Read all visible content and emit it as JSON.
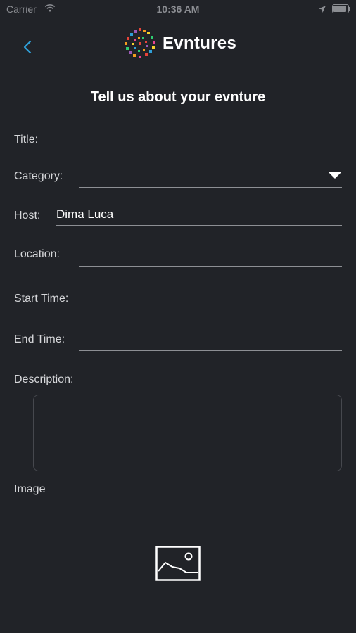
{
  "status_bar": {
    "carrier": "Carrier",
    "time": "10:36 AM",
    "battery_level": 1.0
  },
  "header": {
    "app_title": "Evntures",
    "back_icon": "chevron-left-icon",
    "accent_color": "#2f9fd8"
  },
  "form": {
    "heading": "Tell us about your evnture",
    "title_label": "Title:",
    "title_value": "",
    "category_label": "Category:",
    "category_value": "",
    "host_label": "Host:",
    "host_value": "Dima Luca",
    "location_label": "Location:",
    "location_value": "",
    "start_time_label": "Start Time:",
    "start_time_value": "",
    "end_time_label": "End Time:",
    "end_time_value": "",
    "description_label": "Description:",
    "description_value": "",
    "image_label": "Image",
    "image_icon": "image-placeholder-icon"
  }
}
